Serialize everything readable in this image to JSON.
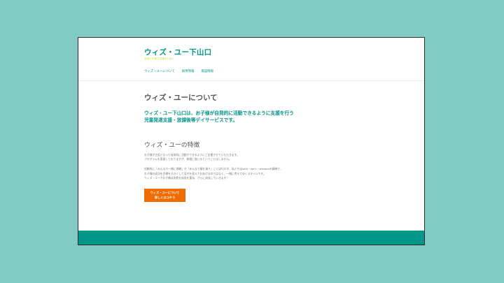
{
  "colors": {
    "outer_background": "#80cbc4",
    "accent": "#009688",
    "tagline": "#cddc39",
    "button": "#ef6c00",
    "footer": "#009688"
  },
  "header": {
    "site_title": "ウィズ・ユー下山口",
    "tagline": "笑顔と子育ち支援のために",
    "nav": [
      {
        "label": "ウィズ・ユーについて"
      },
      {
        "label": "採用情報"
      },
      {
        "label": "施設情報"
      }
    ]
  },
  "main": {
    "page_title": "ウィズ・ユーについて",
    "lead_lines": [
      "ウィズ・ユー下山口は、お子様が自発的に活動できるように支援を行う",
      "児童発達支援・放課後等デイサービスです。"
    ],
    "features_heading": "ウィズ・ユーの特徴",
    "paragraph1": [
      "お子様が主役となって自発的に活動ができるようにご支援させていただきます。",
      "プログラムを用意しておりますが、無理に強いるということはしません。"
    ],
    "paragraph2": [
      "信頼的に「みんなで一緒に挑戦」や「みんなで解を乗り」ことは行わず、私たちはwith・we's・wisdomの精神で、",
      "お子様の成功を目標を大きくして見守を見えておあげるのではなく、一緒に考えてゆくスタイルです。",
      "ウィズ・ユーでお子様は失敗を成長を重ね、さらに成長していきます！"
    ],
    "cta_lines": [
      "ウィズ・ユーについて",
      "詳しくはコチラ"
    ]
  }
}
